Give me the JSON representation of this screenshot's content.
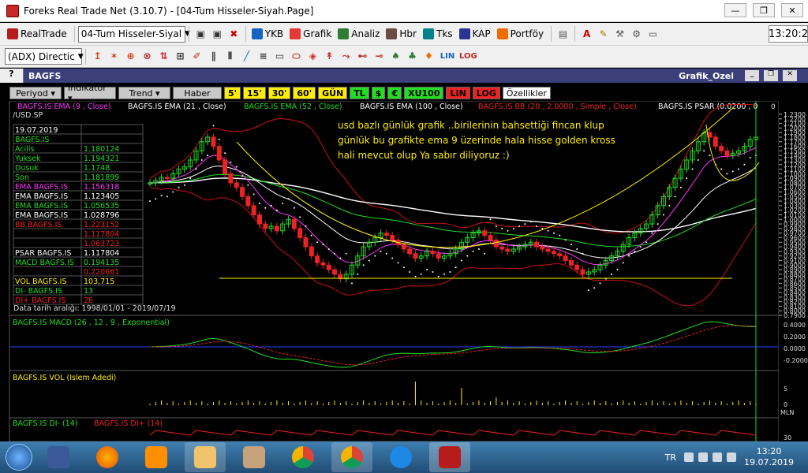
{
  "window": {
    "title": "Foreks Real Trade Net (3.10.7) - [04-Tum Hisseler-Siyah.Page]",
    "min": "—",
    "max": "❐",
    "close": "✕"
  },
  "toolbar1": {
    "realtrade": "RealTrade",
    "page_select": "04-Tum Hisseler-Siyal",
    "ykb": "YKB",
    "grafik": "Grafik",
    "analiz": "Analiz",
    "hbr": "Hbr",
    "tks": "Tks",
    "kap": "KAP",
    "portfoy": "Portföy",
    "clock": "13:20:2"
  },
  "toolbar2": {
    "indicator_select": "(ADX) Directic",
    "tools": [
      "↥",
      "✶",
      "⊕",
      "⊗",
      "⇅",
      "⊞",
      "✐",
      "∥",
      "⦀",
      "╱",
      "≡",
      "▭",
      "⬭",
      "◈",
      "↟",
      "⤳",
      "⊷",
      "⊸",
      "♠",
      "♣",
      "♦",
      "LIN",
      "LOG"
    ]
  },
  "doc": {
    "help": "?",
    "symbol": "BAGFS",
    "graph_name": "Grafik_Ozel"
  },
  "chartbar": {
    "buttons": [
      "Periyod",
      "İndikatör",
      "Trend",
      "Haber"
    ],
    "periods": [
      "5'",
      "15'",
      "30'",
      "60'",
      "GÜN",
      "TL",
      "$",
      "€",
      "XU100",
      "LIN",
      "LOG",
      "Özellikler"
    ]
  },
  "chart": {
    "legend": [
      {
        "text": "BAGFS.IS EMA (9 , Close)",
        "color": "#ff33ff"
      },
      {
        "text": "BAGFS.IS EMA (21 , Close)",
        "color": "#ffffff"
      },
      {
        "text": "BAGFS.IS EMA (52 , Close)",
        "color": "#22dd22"
      },
      {
        "text": "BAGFS.IS EMA (100 , Close)",
        "color": "#ffffff"
      },
      {
        "text": "BAGFS.IS BB (20 , 2.0000 , Simple , Close)",
        "color": "#ee2222"
      },
      {
        "text": "BAGFS.IS PSAR (0.0200 , 0",
        "color": "#ffffff"
      }
    ],
    "pair": "/USD.SP",
    "annotation": [
      "usd bazlı günlük grafik ..birilerinin bahsettiği fincan klup",
      "günlük bu grafikte ema 9 üzerinde hala hisse golden kross",
      "hali mevcut olup Ya sabır diliyoruz :)"
    ],
    "date_range": "Data tarih aralığı: 1998/01/01 - 2019/07/19",
    "info_rows": [
      {
        "label": "19.07.2019",
        "value": "",
        "color": "#ffffff"
      },
      {
        "label": "BAGFS.IS",
        "value": "",
        "color": "#22dd22"
      },
      {
        "label": " Acilis",
        "value": "1.180124",
        "color": "#22dd22"
      },
      {
        "label": " Yuksek",
        "value": "1.194321",
        "color": "#22dd22"
      },
      {
        "label": " Dusuk",
        "value": "1.1748",
        "color": "#22dd22"
      },
      {
        "label": " Son",
        "value": "1.181899",
        "color": "#22dd22"
      },
      {
        "label": "EMA BAGFS.IS",
        "value": "1.156318",
        "color": "#ff33ff"
      },
      {
        "label": "EMA BAGFS.IS",
        "value": "1.123405",
        "color": "#ffffff"
      },
      {
        "label": "EMA BAGFS.IS",
        "value": "1.056535",
        "color": "#22dd22"
      },
      {
        "label": "EMA BAGFS.IS",
        "value": "1.028796",
        "color": "#ffffff"
      },
      {
        "label": "BB BAGFS.IS",
        "value": "1.223152",
        "color": "#ee2222"
      },
      {
        "label": "",
        "value": "1.117804",
        "color": "#ee2222"
      },
      {
        "label": "",
        "value": "1.063723",
        "color": "#ee2222"
      },
      {
        "label": "PSAR BAGFS.IS",
        "value": "1.117804",
        "color": "#ffffff"
      },
      {
        "label": "MACD BAGFS.IS",
        "value": "0.194135",
        "color": "#22dd22"
      },
      {
        "label": "",
        "value": "0.220661",
        "color": "#ee2222"
      },
      {
        "label": "VOL BAGFS.IS",
        "value": "103,715",
        "color": "#ffee00"
      },
      {
        "label": "DI- BAGFS.IS",
        "value": "13",
        "color": "#22dd22"
      },
      {
        "label": "DI+ BAGFS.IS",
        "value": "26",
        "color": "#ee2222"
      }
    ],
    "price_axis": [
      "1.2300",
      "1.2200",
      "1.2100",
      "1.2000",
      "1.1900",
      "1.1800",
      "1.1700",
      "1.1600",
      "1.1500",
      "1.1400",
      "1.1300",
      "1.1200",
      "1.1100",
      "1.1000",
      "1.0900",
      "1.0800",
      "1.0700",
      "1.0600",
      "1.0500",
      "1.0400",
      "1.0300",
      "1.0200",
      "1.0100",
      "1.0000",
      "0.9900",
      "0.9800",
      "0.9700",
      "0.9600",
      "0.9500",
      "0.9400",
      "0.9300",
      "0.9200",
      "0.9100",
      "0.9000",
      "0.8900",
      "0.8800",
      "0.8700",
      "0.8600",
      "0.8500",
      "0.8400",
      "0.8300",
      "0.8200",
      "0.8100",
      "0.8000",
      "0.7900"
    ],
    "price_axis_top": "0",
    "macd": {
      "title": "BAGFS.IS MACD (26 , 12 , 9 , Exponential)",
      "axis": [
        "0.4000",
        "0.2000",
        "0.0000",
        "-0.2000"
      ]
    },
    "vol": {
      "title": "BAGFS.IS VOL (Islem Adedi)",
      "axis": [
        "5",
        "0"
      ],
      "unit": "MLN"
    },
    "di": {
      "title_minus": "BAGFS.IS DI- (14)",
      "title_plus": "BAGFS.IS DI+ (14)",
      "axis": [
        "30"
      ]
    }
  },
  "taskbar": {
    "lang": "TR",
    "time": "13:20",
    "date": "19.07.2019"
  }
}
